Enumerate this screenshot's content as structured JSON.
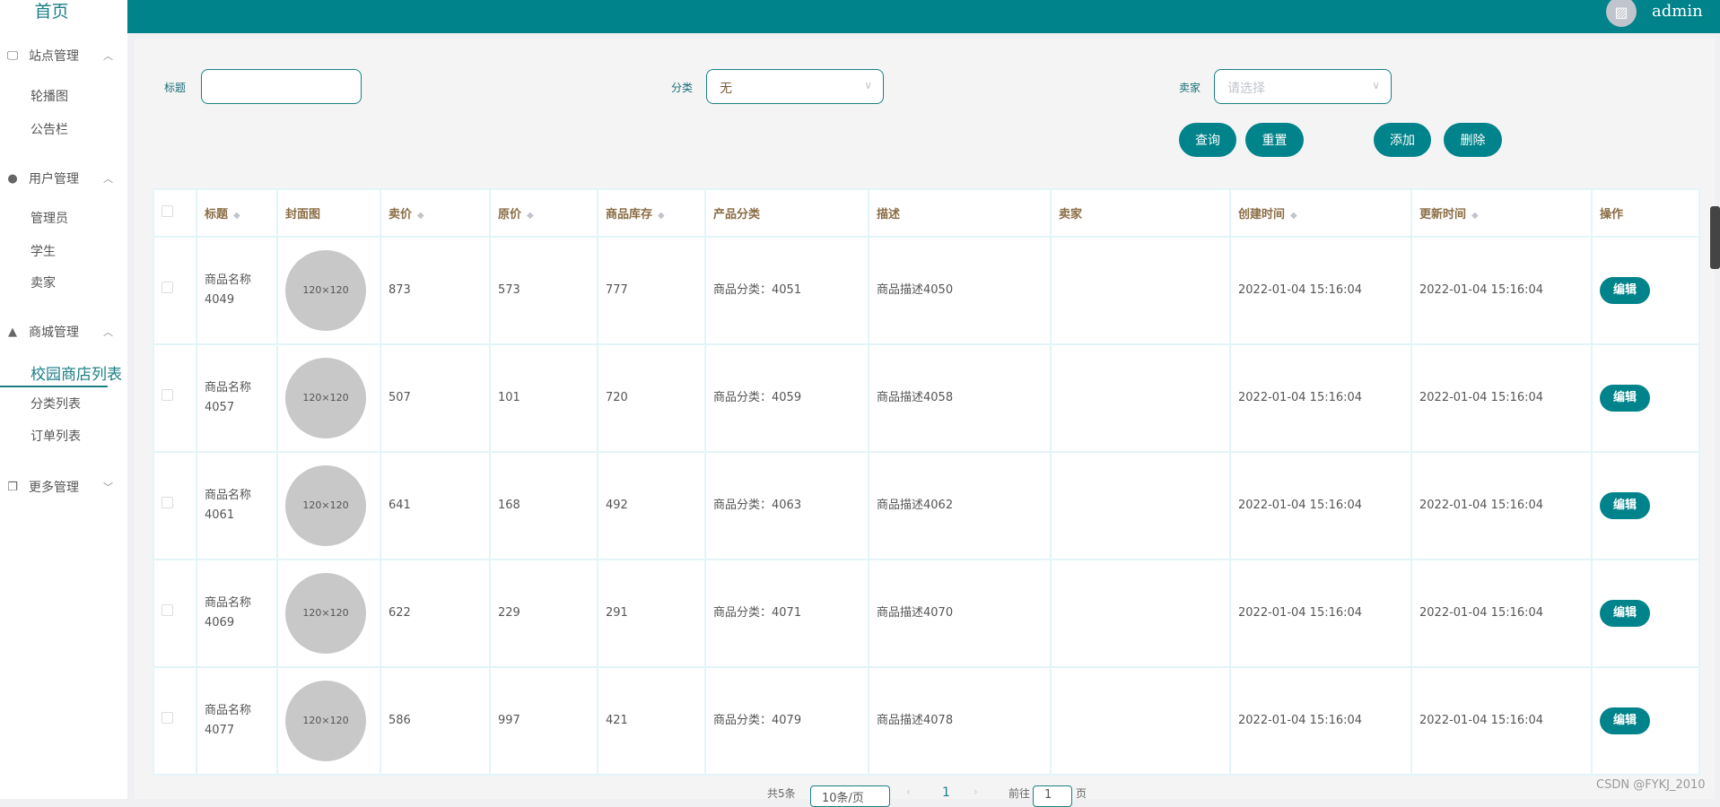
{
  "header": {
    "username": "admin"
  },
  "sidebar": {
    "home": "首页",
    "groups": [
      {
        "label": "站点管理",
        "items": [
          "轮播图",
          "公告栏"
        ]
      },
      {
        "label": "用户管理",
        "items": [
          "管理员",
          "学生",
          "卖家"
        ]
      },
      {
        "label": "商城管理",
        "items": [
          "校园商店列表",
          "分类列表",
          "订单列表"
        ]
      },
      {
        "label": "更多管理",
        "items": []
      }
    ]
  },
  "filters": {
    "title_label": "标题",
    "title_value": "",
    "category_label": "分类",
    "category_value": "无",
    "seller_label": "卖家",
    "seller_placeholder": "请选择"
  },
  "buttons": {
    "query": "查询",
    "reset": "重置",
    "add": "添加",
    "delete": "删除"
  },
  "table": {
    "columns": [
      "标题",
      "封面图",
      "卖价",
      "原价",
      "商品库存",
      "产品分类",
      "描述",
      "卖家",
      "创建时间",
      "更新时间",
      "操作"
    ],
    "image_placeholder": "120×120",
    "edit_label": "编辑",
    "rows": [
      {
        "title": "商品名称4049",
        "price": "873",
        "original": "573",
        "stock": "777",
        "category": "商品分类：4051",
        "desc": "商品描述4050",
        "seller": "",
        "created": "2022-01-04 15:16:04",
        "updated": "2022-01-04 15:16:04"
      },
      {
        "title": "商品名称4057",
        "price": "507",
        "original": "101",
        "stock": "720",
        "category": "商品分类：4059",
        "desc": "商品描述4058",
        "seller": "",
        "created": "2022-01-04 15:16:04",
        "updated": "2022-01-04 15:16:04"
      },
      {
        "title": "商品名称4061",
        "price": "641",
        "original": "168",
        "stock": "492",
        "category": "商品分类：4063",
        "desc": "商品描述4062",
        "seller": "",
        "created": "2022-01-04 15:16:04",
        "updated": "2022-01-04 15:16:04"
      },
      {
        "title": "商品名称4069",
        "price": "622",
        "original": "229",
        "stock": "291",
        "category": "商品分类：4071",
        "desc": "商品描述4070",
        "seller": "",
        "created": "2022-01-04 15:16:04",
        "updated": "2022-01-04 15:16:04"
      },
      {
        "title": "商品名称4077",
        "price": "586",
        "original": "997",
        "stock": "421",
        "category": "商品分类：4079",
        "desc": "商品描述4078",
        "seller": "",
        "created": "2022-01-04 15:16:04",
        "updated": "2022-01-04 15:16:04"
      }
    ]
  },
  "pagination": {
    "total": "共5条",
    "page_size": "10条/页",
    "current_page": "1",
    "goto_label": "前往",
    "goto_value": "1",
    "page_suffix": "页"
  },
  "watermark": "CSDN @FYKJ_2010"
}
